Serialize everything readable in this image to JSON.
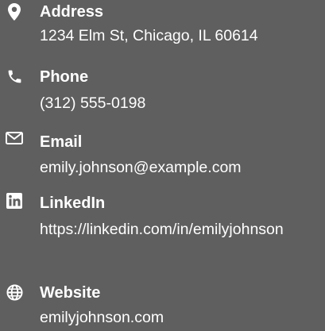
{
  "contacts": [
    {
      "icon": "map-pin-icon",
      "label": "Address",
      "value": "1234 Elm St, Chicago, IL 60614"
    },
    {
      "icon": "phone-icon",
      "label": "Phone",
      "value": "(312) 555-0198"
    },
    {
      "icon": "envelope-icon",
      "label": "Email",
      "value": "emily.johnson@example.com"
    },
    {
      "icon": "linkedin-icon",
      "label": "LinkedIn",
      "value": "https://linkedin.com/in/emilyjohnson"
    },
    {
      "icon": "globe-icon",
      "label": "Website",
      "value": "emilyjohnson.com"
    }
  ],
  "colors": {
    "background": "#5f5f5f",
    "text": "#ffffff"
  }
}
